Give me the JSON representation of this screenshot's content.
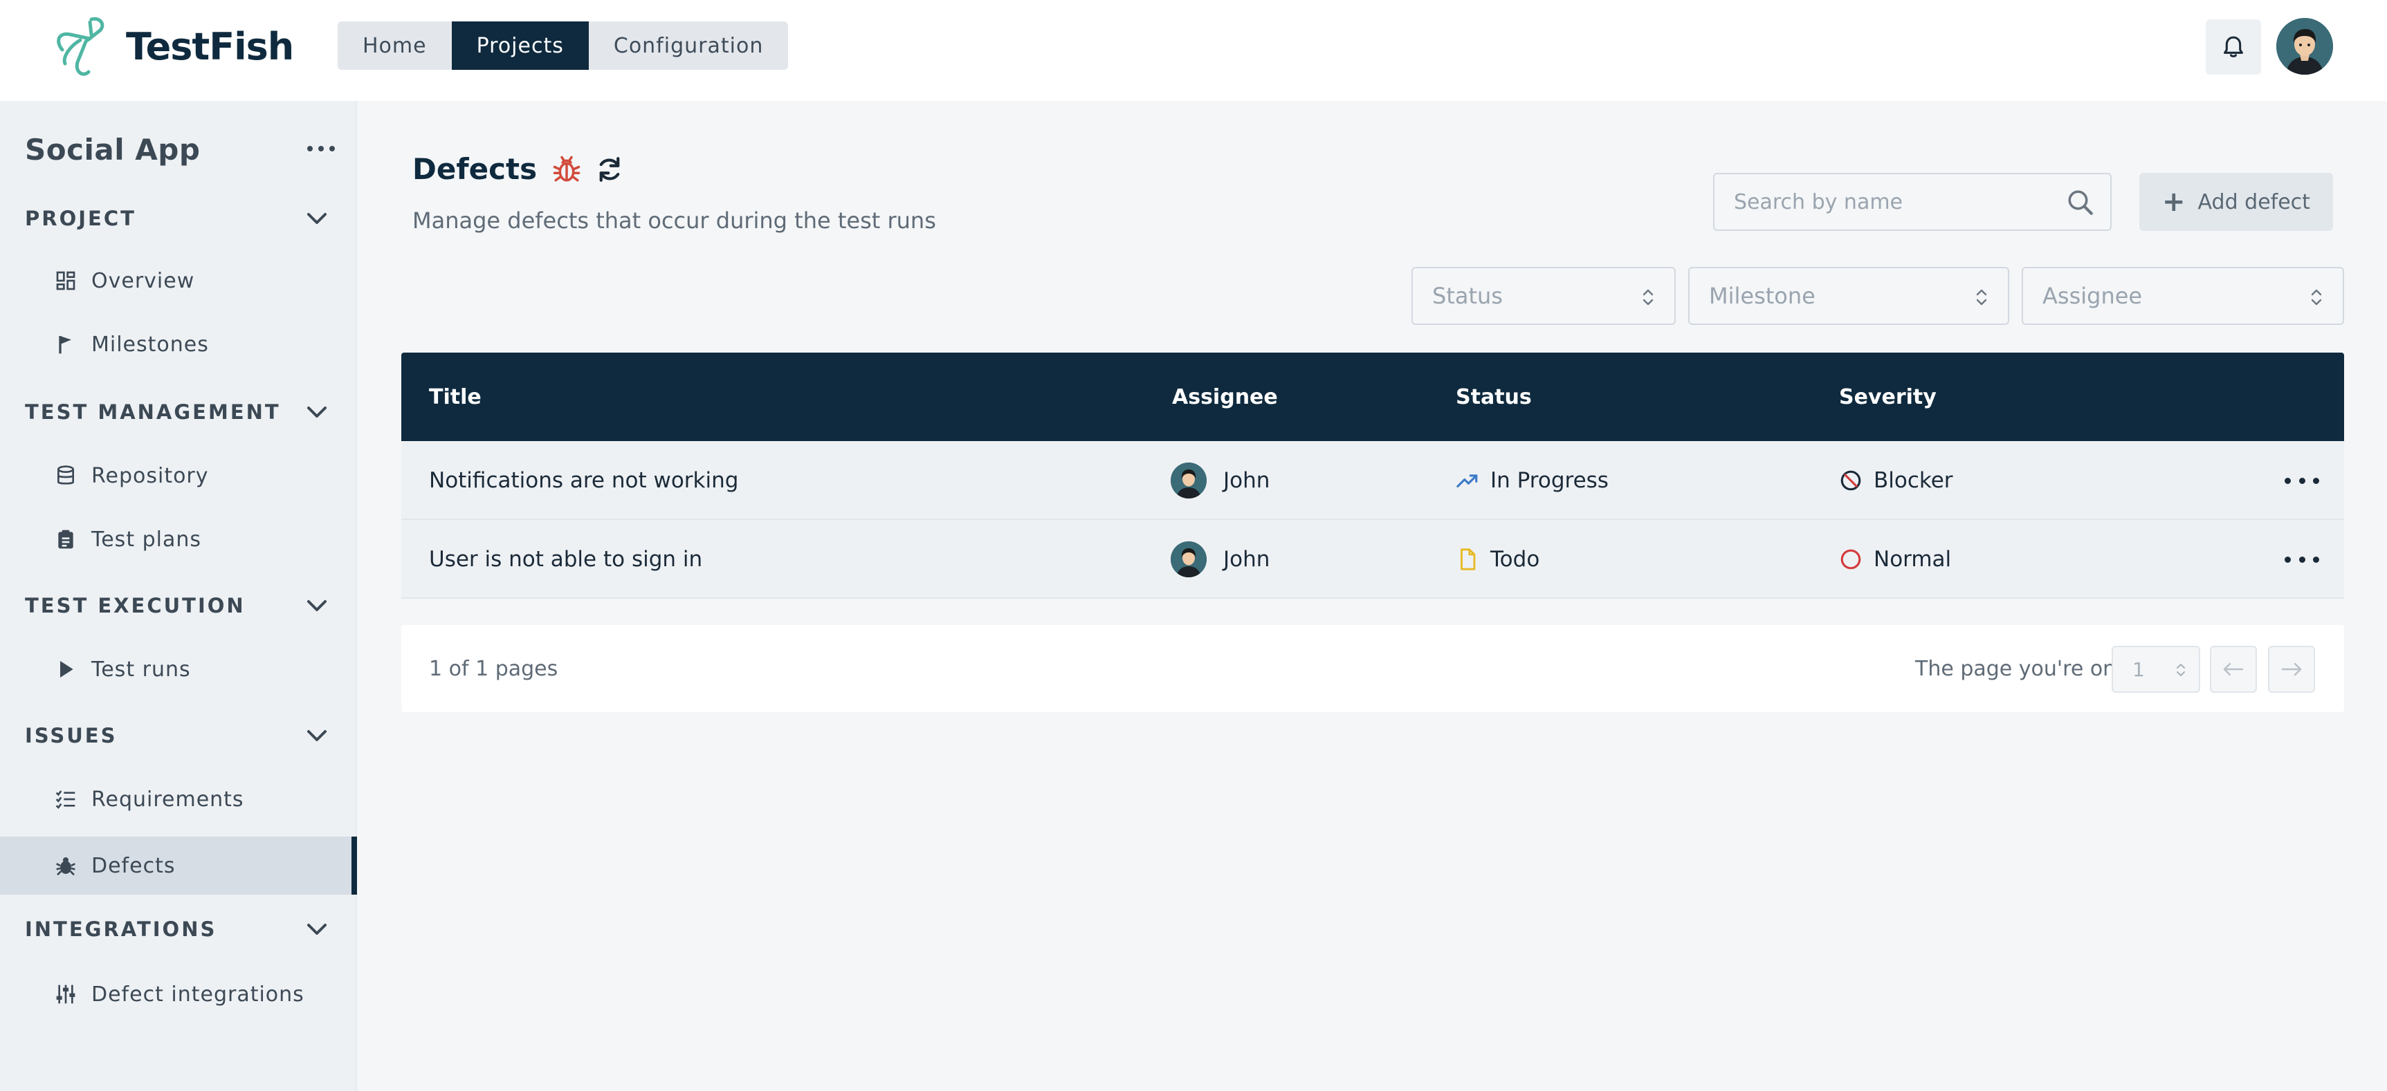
{
  "app": {
    "name": "TestFish"
  },
  "nav": {
    "tabs": [
      {
        "label": "Home"
      },
      {
        "label": "Projects"
      },
      {
        "label": "Configuration"
      }
    ],
    "active": "Projects"
  },
  "sidebar": {
    "project_title": "Social App",
    "sections": [
      {
        "label": "PROJECT",
        "items": [
          {
            "label": "Overview",
            "icon": "grid-icon"
          },
          {
            "label": "Milestones",
            "icon": "flag-icon"
          }
        ]
      },
      {
        "label": "TEST MANAGEMENT",
        "items": [
          {
            "label": "Repository",
            "icon": "database-icon"
          },
          {
            "label": "Test plans",
            "icon": "clipboard-icon"
          }
        ]
      },
      {
        "label": "TEST EXECUTION",
        "items": [
          {
            "label": "Test runs",
            "icon": "play-icon"
          }
        ]
      },
      {
        "label": "ISSUES",
        "items": [
          {
            "label": "Requirements",
            "icon": "checklist-icon"
          },
          {
            "label": "Defects",
            "icon": "bug-icon",
            "active": true
          }
        ]
      },
      {
        "label": "INTEGRATIONS",
        "items": [
          {
            "label": "Defect integrations",
            "icon": "sliders-icon"
          }
        ]
      }
    ]
  },
  "main": {
    "title": "Defects",
    "subtitle": "Manage defects that occur during the test runs",
    "search_placeholder": "Search by name",
    "add_button": "Add defect",
    "filters": [
      {
        "placeholder": "Status"
      },
      {
        "placeholder": "Milestone"
      },
      {
        "placeholder": "Assignee"
      }
    ]
  },
  "table": {
    "headers": {
      "title": "Title",
      "assignee": "Assignee",
      "status": "Status",
      "severity": "Severity"
    },
    "rows": [
      {
        "title": "Notifications are not working",
        "assignee": "John",
        "status": "In Progress",
        "status_icon": "trending-up-icon",
        "severity": "Blocker",
        "severity_icon": "ban-icon"
      },
      {
        "title": "User is not able to sign in",
        "assignee": "John",
        "status": "Todo",
        "status_icon": "file-icon",
        "severity": "Normal",
        "severity_icon": "circle-icon"
      }
    ]
  },
  "pagination": {
    "info": "1 of 1 pages",
    "label": "The page you're on",
    "current": "1"
  },
  "colors": {
    "brand_dark": "#0f2a3e",
    "logo_accent": "#4fb6a3",
    "bug_red": "#d24a3a",
    "status_blue": "#3b79c9",
    "todo_yellow": "#e7b923",
    "severity_red": "#d33b3b"
  }
}
